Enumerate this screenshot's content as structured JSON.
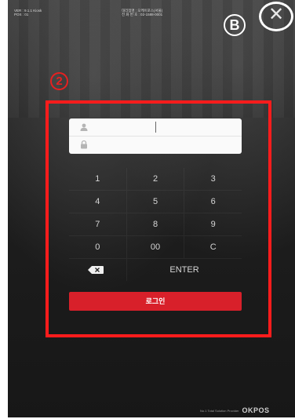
{
  "header": {
    "info_left": [
      "VER : 9.1.1 Kiosk",
      "POS : 01"
    ],
    "info_right": [
      "대리점명 : 오케이포스(서울)",
      "전 화 번 호 : 02-1588-0001"
    ]
  },
  "annotations": {
    "b_marker": "B",
    "step_marker": "2"
  },
  "close_button": {
    "label": "✕"
  },
  "login_form": {
    "user_id_value": "",
    "password_value": ""
  },
  "keypad": {
    "rows": [
      [
        "1",
        "2",
        "3"
      ],
      [
        "4",
        "5",
        "6"
      ],
      [
        "7",
        "8",
        "9"
      ],
      [
        "0",
        "00",
        "C"
      ]
    ],
    "enter_label": "ENTER"
  },
  "login_button": {
    "label": "로그인"
  },
  "footer": {
    "tagline": "No.1 Total Solution Provider",
    "brand": "OKPOS"
  },
  "colors": {
    "accent_red": "#d8202a",
    "highlight_red": "#ff1c1c",
    "background": "#1c1c1c"
  }
}
